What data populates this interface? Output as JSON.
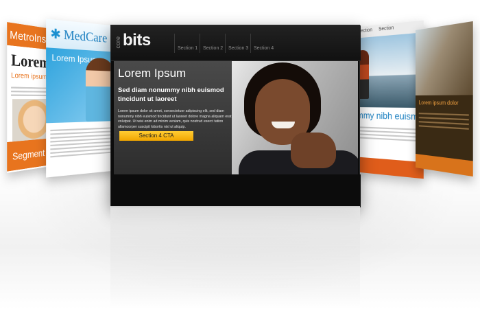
{
  "main": {
    "brand_vertical": "core",
    "brand": "bits",
    "nav": [
      "Section 1",
      "Section 2",
      "Section 3",
      "Section 4"
    ],
    "hero": {
      "title": "Lorem Ipsum",
      "subtitle": "Sed diam nonummy nibh euismod tincidunt ut laoreet",
      "body": "Lorem ipsum dolor sit amet, consectetuer adipiscing elit, sed diam nonummy nibh euismod tincidunt ut laoreet dolore magna aliquam erat volutpat. Ut wisi enim ad minim veniam, quis nostrud exerci tation ullamcorper suscipit lobortis nisl ut aliquip.",
      "cta_label": "Section 4 CTA"
    }
  },
  "cards": {
    "metro": {
      "header": "MetroInsur",
      "title": "Lorem ip",
      "subtitle": "Lorem ipsum dol",
      "segment": "Segment I"
    },
    "medcare": {
      "logo": "MedCare",
      "logo_mark": "✱",
      "hero_title": "Lorem Ipsum"
    },
    "right1": {
      "tabs": [
        "Section",
        "Section"
      ],
      "title": "mmy nibh euismod"
    },
    "right2": {
      "caption": "Lorem ipsum dolor"
    }
  },
  "colors": {
    "metro_orange": "#e8741e",
    "medcare_blue": "#1a7fc0",
    "cta_yellow": "#f0a500",
    "main_bg": "#0c0c0c"
  }
}
